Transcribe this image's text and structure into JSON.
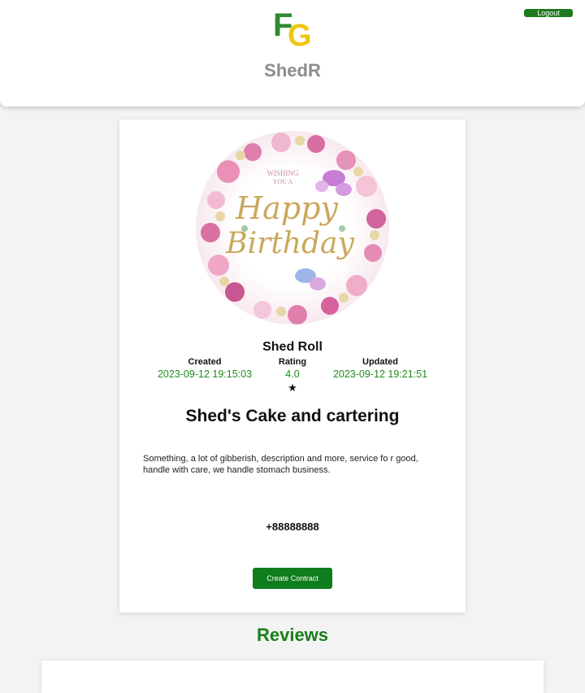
{
  "header": {
    "logo_letters": [
      "F",
      "G"
    ],
    "app_title": "ShedR",
    "logout_label": "Logout"
  },
  "colors": {
    "accent_green": "#1e7b1e",
    "logo_green": "#2f8a2f",
    "logo_yellow": "#f1c40f",
    "title_gray": "#8c8c8c"
  },
  "shop": {
    "avatar_text": [
      "WISHING",
      "YOU A",
      "Happy",
      "Birthday"
    ],
    "name": "Shed Roll",
    "created_label": "Created",
    "created_value": "2023-09-12 19:15:03",
    "rating_label": "Rating",
    "rating_value": "4.0",
    "rating_star": "★",
    "updated_label": "Updated",
    "updated_value": "2023-09-12 19:21:51",
    "business_title": "Shed's Cake and cartering",
    "description": "Something, a lot of gibberish, description and more, service fo r good, handle with care, we handle stomach business.",
    "phone": "+88888888",
    "contract_button": "Create Contract"
  },
  "reviews": {
    "title": "Reviews"
  }
}
